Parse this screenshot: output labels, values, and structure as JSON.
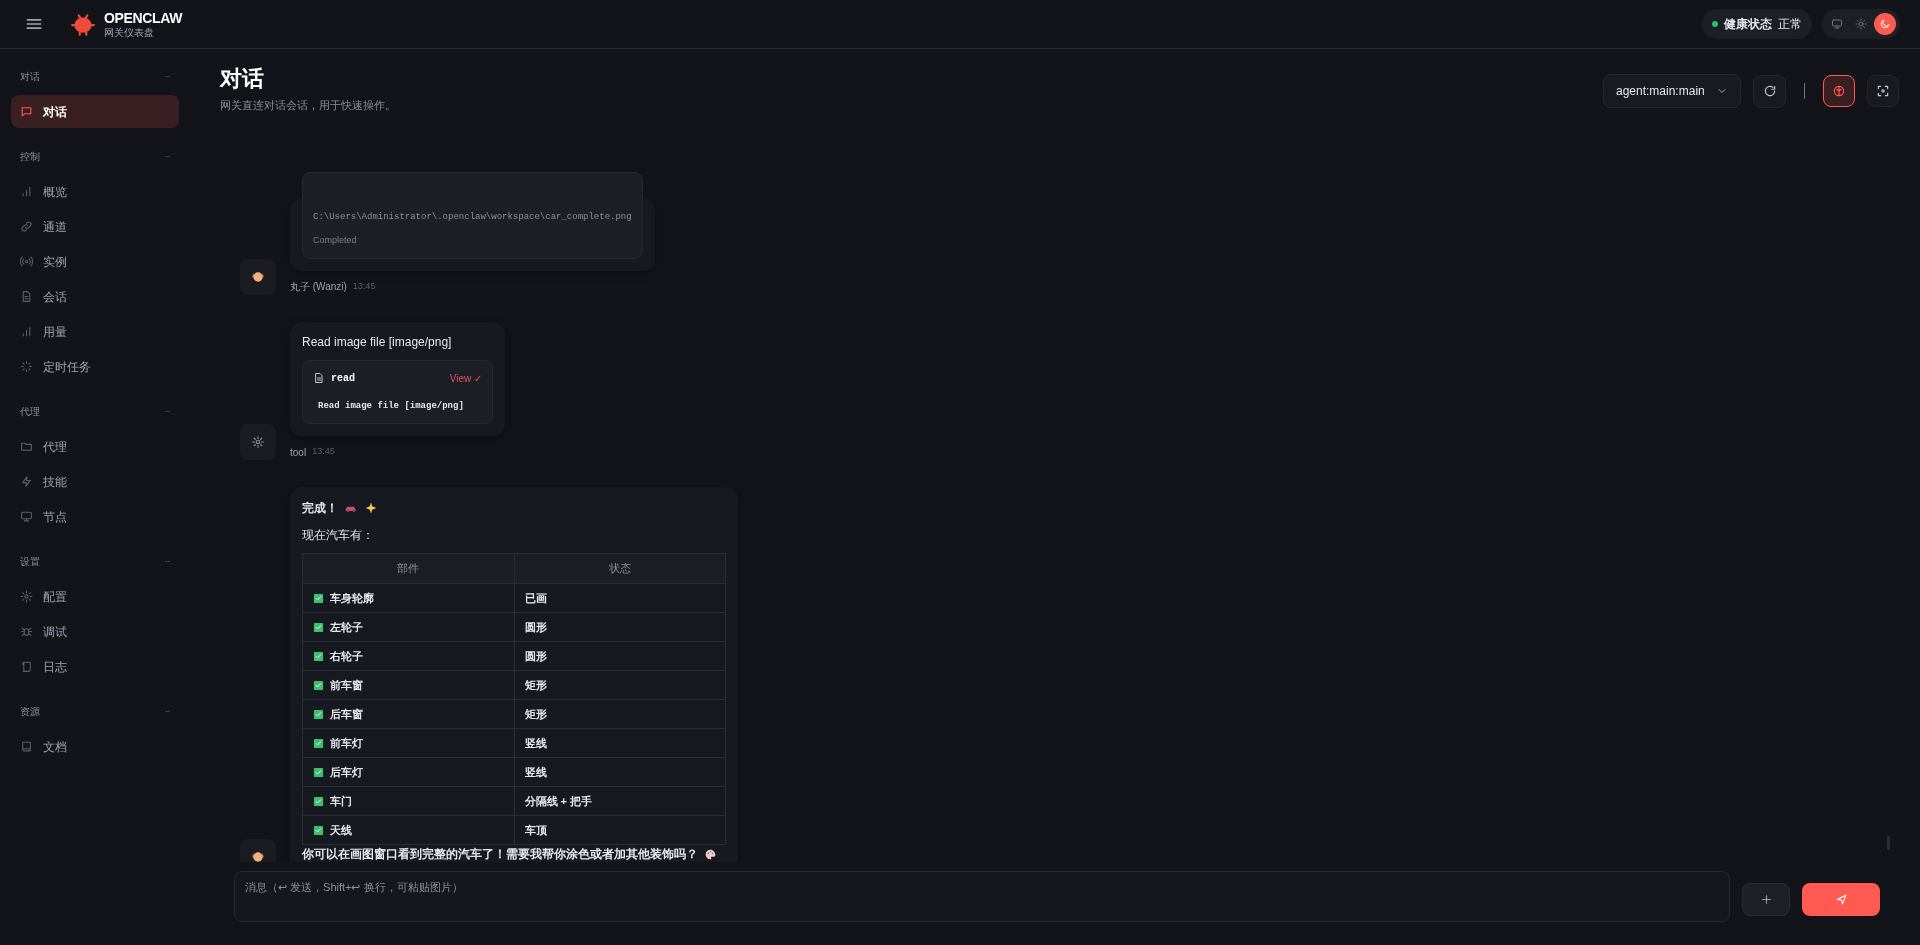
{
  "header": {
    "brand": "OPENCLAW",
    "subtitle": "网关仪表盘",
    "health": {
      "label": "健康状态",
      "value": "正常",
      "ok": true
    },
    "theme_modes": [
      {
        "kind": "system",
        "selected": false
      },
      {
        "kind": "light",
        "selected": false
      },
      {
        "kind": "dark",
        "selected": true
      }
    ]
  },
  "sidebar": {
    "sections": [
      {
        "title": "对话",
        "items": [
          {
            "label": "对话",
            "kind": "chat",
            "selected": true
          }
        ]
      },
      {
        "title": "控制",
        "items": [
          {
            "label": "概览",
            "kind": "bars",
            "selected": false
          },
          {
            "label": "通道",
            "kind": "link",
            "selected": false
          },
          {
            "label": "实例",
            "kind": "radio",
            "selected": false
          },
          {
            "label": "会话",
            "kind": "file",
            "selected": false
          },
          {
            "label": "用量",
            "kind": "bars",
            "selected": false
          },
          {
            "label": "定时任务",
            "kind": "loader",
            "selected": false
          }
        ]
      },
      {
        "title": "代理",
        "items": [
          {
            "label": "代理",
            "kind": "folder",
            "selected": false
          },
          {
            "label": "技能",
            "kind": "zap",
            "selected": false
          },
          {
            "label": "节点",
            "kind": "monitor",
            "selected": false
          }
        ]
      },
      {
        "title": "设置",
        "items": [
          {
            "label": "配置",
            "kind": "gear",
            "selected": false
          },
          {
            "label": "调试",
            "kind": "bug",
            "selected": false
          },
          {
            "label": "日志",
            "kind": "scroll",
            "selected": false
          }
        ]
      },
      {
        "title": "资源",
        "items": [
          {
            "label": "文档",
            "kind": "book",
            "selected": false
          }
        ]
      }
    ]
  },
  "page": {
    "title": "对话",
    "subtitle": "网关直连对话会话，用于快速操作。",
    "session_select": "agent:main:main",
    "thinking_toggle": {
      "on": true
    }
  },
  "messages": [
    {
      "kind": "agent",
      "author": "丸子 (Wanzi)",
      "time": "13:45",
      "blocks": [
        {
          "kind": "tool_card",
          "path": "C:\\Users\\Administrator\\.openclaw\\workspace\\car_complete.png",
          "status": "Completed"
        }
      ]
    },
    {
      "kind": "tool",
      "author": "tool",
      "time": "13:45",
      "blocks": [
        {
          "kind": "text",
          "text": "Read image file [image/png]"
        },
        {
          "kind": "tool_call",
          "name": "read",
          "action": "View ✓",
          "output": "Read image file [image/png]"
        }
      ]
    },
    {
      "kind": "agent",
      "blocks": [
        {
          "kind": "done_line",
          "text": "完成！"
        },
        {
          "kind": "text",
          "text": "现在汽车有："
        },
        {
          "kind": "table",
          "columns": [
            "部件",
            "状态"
          ],
          "rows": [
            {
              "part": "车身轮廓",
              "state": "已画"
            },
            {
              "part": "左轮子",
              "state": "圆形"
            },
            {
              "part": "右轮子",
              "state": "圆形"
            },
            {
              "part": "前车窗",
              "state": "矩形"
            },
            {
              "part": "后车窗",
              "state": "矩形"
            },
            {
              "part": "前车灯",
              "state": "竖线"
            },
            {
              "part": "后车灯",
              "state": "竖线"
            },
            {
              "part": "车门",
              "state": "分隔线 + 把手"
            },
            {
              "part": "天线",
              "state": "车顶"
            }
          ]
        },
        {
          "kind": "closing_line",
          "text": "你可以在画图窗口看到完整的汽车了！需要我帮你涂色或者加其他装饰吗？"
        }
      ]
    }
  ],
  "composer": {
    "placeholder": "消息（↩ 发送，Shift+↩ 换行，可粘贴图片）"
  }
}
